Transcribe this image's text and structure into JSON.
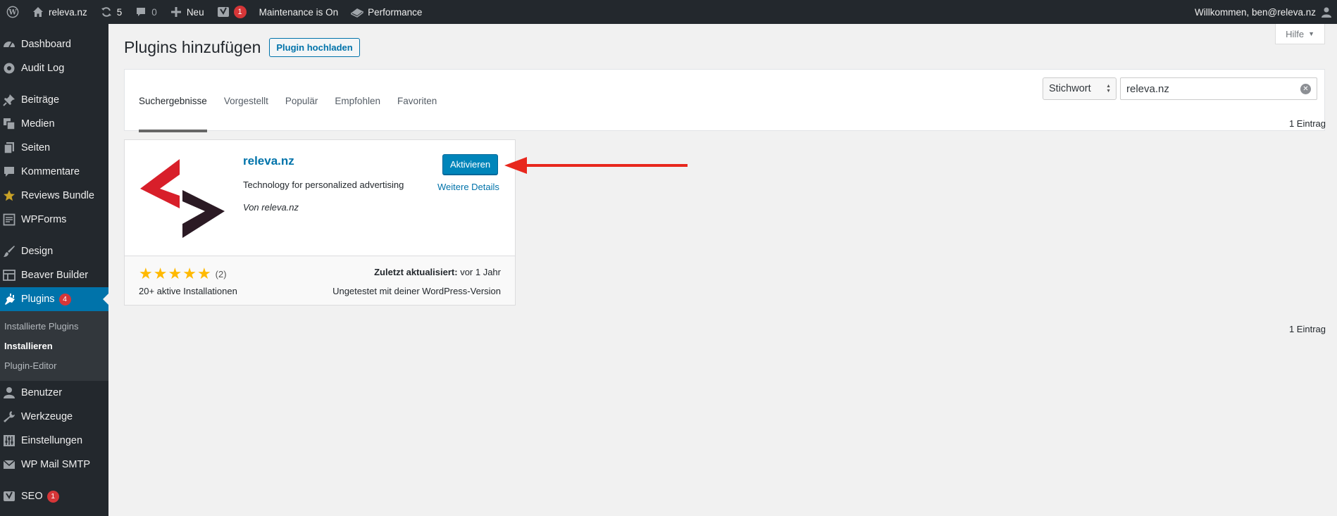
{
  "adminbar": {
    "site_name": "releva.nz",
    "updates_count": "5",
    "comments_count": "0",
    "new_label": "Neu",
    "yoast_badge": "1",
    "maintenance_label": "Maintenance is On",
    "performance_label": "Performance",
    "welcome_text": "Willkommen, ben@releva.nz"
  },
  "sidebar": {
    "items": [
      {
        "label": "Dashboard"
      },
      {
        "label": "Audit Log"
      },
      {
        "label": "Beiträge"
      },
      {
        "label": "Medien"
      },
      {
        "label": "Seiten"
      },
      {
        "label": "Kommentare"
      },
      {
        "label": "Reviews Bundle"
      },
      {
        "label": "WPForms"
      },
      {
        "label": "Design"
      },
      {
        "label": "Beaver Builder"
      },
      {
        "label": "Plugins",
        "badge": "4"
      },
      {
        "label": "Benutzer"
      },
      {
        "label": "Werkzeuge"
      },
      {
        "label": "Einstellungen"
      },
      {
        "label": "WP Mail SMTP"
      },
      {
        "label": "SEO",
        "badge": "1"
      }
    ],
    "plugins_submenu": [
      "Installierte Plugins",
      "Installieren",
      "Plugin-Editor"
    ]
  },
  "help_label": "Hilfe",
  "page": {
    "title": "Plugins hinzufügen",
    "upload_label": "Plugin hochladen",
    "tabs": [
      "Suchergebnisse",
      "Vorgestellt",
      "Populär",
      "Empfohlen",
      "Favoriten"
    ],
    "search_type": "Stichwort",
    "search_value": "releva.nz",
    "count_text": "1 Eintrag"
  },
  "plugin": {
    "name": "releva.nz",
    "description": "Technology for personalized advertising",
    "author": "Von releva.nz",
    "activate_label": "Aktivieren",
    "details_label": "Weitere Details",
    "rating_stars": 5,
    "rating_count": "(2)",
    "installs": "20+ aktive Installationen",
    "last_updated_label": "Zuletzt aktualisiert:",
    "last_updated_value": "vor 1 Jahr",
    "compatibility": "Ungetestet mit deiner WordPress-Version"
  },
  "colors": {
    "adminbar_bg": "#23282d",
    "active_blue": "#0073aa",
    "badge_red": "#d63638",
    "star": "#ffb900",
    "annotation_arrow": "#e8271d",
    "logo_red": "#d81f2a",
    "logo_dark": "#2b1a24"
  }
}
